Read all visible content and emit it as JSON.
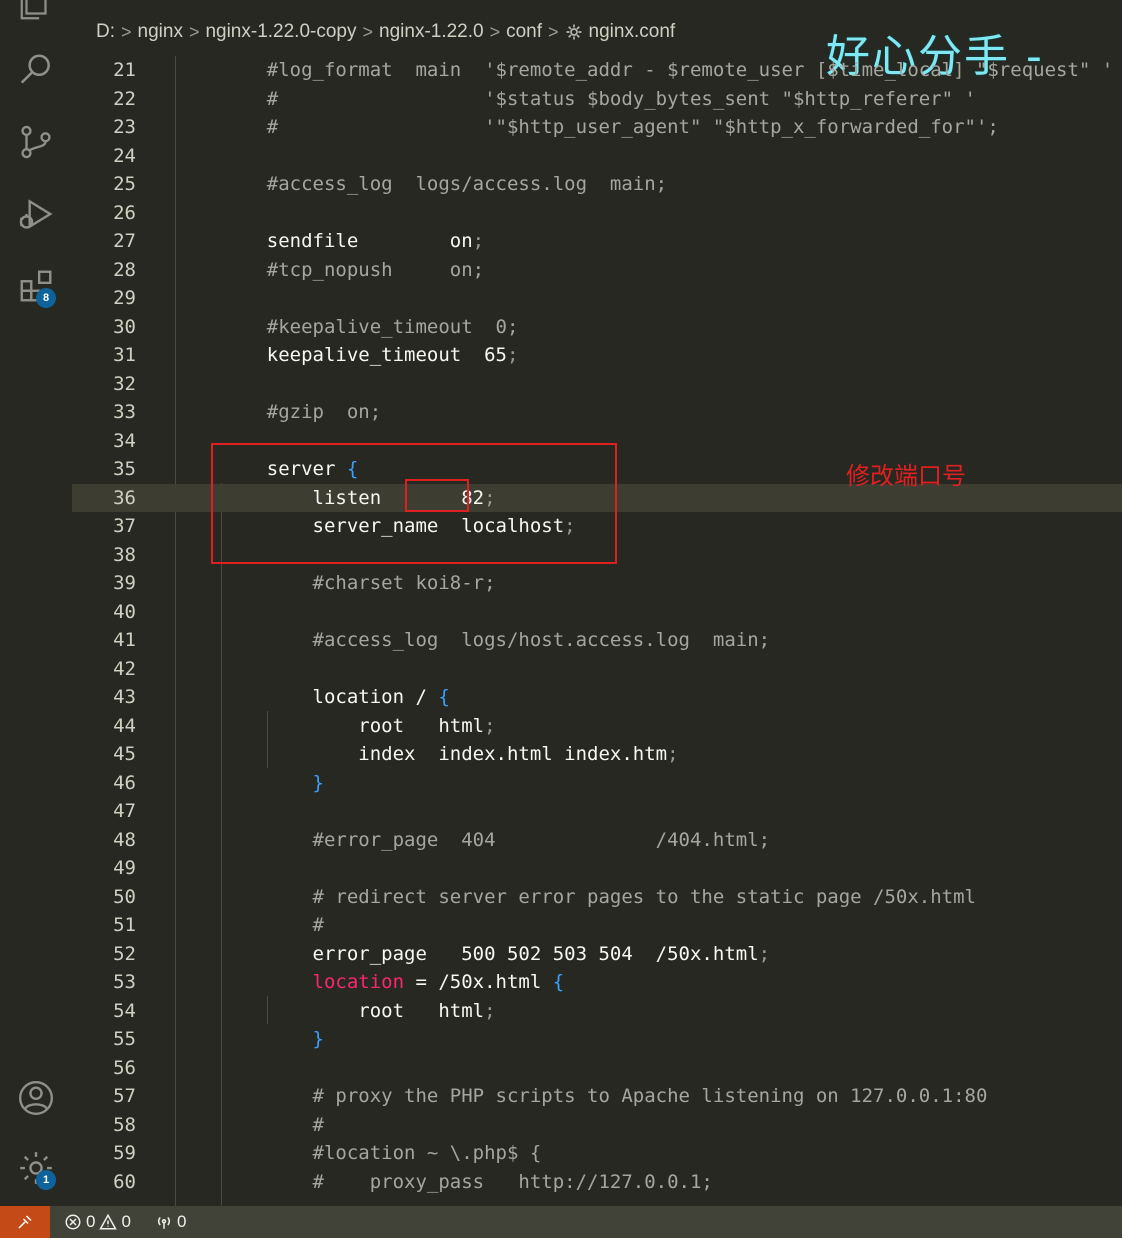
{
  "breadcrumb": {
    "items": [
      "D:",
      "nginx",
      "nginx-1.22.0-copy",
      "nginx-1.22.0",
      "conf",
      "nginx.conf"
    ],
    "separator": ">"
  },
  "watermark": "好心分手 -",
  "annotation": "修改端口号",
  "activity_bar": {
    "icons": [
      "explorer-icon",
      "search-icon",
      "source-control-icon",
      "run-debug-icon",
      "extensions-icon",
      "account-icon",
      "settings-gear-icon"
    ],
    "extensions_badge": "8",
    "settings_badge": "1"
  },
  "status_bar": {
    "errors": "0",
    "warnings": "0",
    "ports": "0"
  },
  "colors": {
    "background": "#272822",
    "highlight": "#e02020",
    "badge": "#0e639c",
    "remote": "#c44a17",
    "watermark": "#7fe8f2"
  },
  "lines": [
    {
      "n": "21",
      "text": "    #log_format  main  '$remote_addr - $remote_user [$time_local] \"$request\" '"
    },
    {
      "n": "22",
      "text": "    #                  '$status $body_bytes_sent \"$http_referer\" '"
    },
    {
      "n": "23",
      "text": "    #                  '\"$http_user_agent\" \"$http_x_forwarded_for\"';"
    },
    {
      "n": "24",
      "text": ""
    },
    {
      "n": "25",
      "text": "    #access_log  logs/access.log  main;"
    },
    {
      "n": "26",
      "text": ""
    },
    {
      "n": "27",
      "text": "    sendfile        on;"
    },
    {
      "n": "28",
      "text": "    #tcp_nopush     on;"
    },
    {
      "n": "29",
      "text": ""
    },
    {
      "n": "30",
      "text": "    #keepalive_timeout  0;"
    },
    {
      "n": "31",
      "text": "    keepalive_timeout  65;"
    },
    {
      "n": "32",
      "text": ""
    },
    {
      "n": "33",
      "text": "    #gzip  on;"
    },
    {
      "n": "34",
      "text": ""
    },
    {
      "n": "35",
      "text": "    server {"
    },
    {
      "n": "36",
      "text": "        listen       82;"
    },
    {
      "n": "37",
      "text": "        server_name  localhost;"
    },
    {
      "n": "38",
      "text": ""
    },
    {
      "n": "39",
      "text": "        #charset koi8-r;"
    },
    {
      "n": "40",
      "text": ""
    },
    {
      "n": "41",
      "text": "        #access_log  logs/host.access.log  main;"
    },
    {
      "n": "42",
      "text": ""
    },
    {
      "n": "43",
      "text": "        location / {"
    },
    {
      "n": "44",
      "text": "            root   html;"
    },
    {
      "n": "45",
      "text": "            index  index.html index.htm;"
    },
    {
      "n": "46",
      "text": "        }"
    },
    {
      "n": "47",
      "text": ""
    },
    {
      "n": "48",
      "text": "        #error_page  404              /404.html;"
    },
    {
      "n": "49",
      "text": ""
    },
    {
      "n": "50",
      "text": "        # redirect server error pages to the static page /50x.html"
    },
    {
      "n": "51",
      "text": "        #"
    },
    {
      "n": "52",
      "text": "        error_page   500 502 503 504  /50x.html;"
    },
    {
      "n": "53",
      "text": "        location = /50x.html {"
    },
    {
      "n": "54",
      "text": "            root   html;"
    },
    {
      "n": "55",
      "text": "        }"
    },
    {
      "n": "56",
      "text": ""
    },
    {
      "n": "57",
      "text": "        # proxy the PHP scripts to Apache listening on 127.0.0.1:80"
    },
    {
      "n": "58",
      "text": "        #"
    },
    {
      "n": "59",
      "text": "        #location ~ \\.php$ {"
    },
    {
      "n": "60",
      "text": "        #    proxy_pass   http://127.0.0.1;"
    }
  ]
}
